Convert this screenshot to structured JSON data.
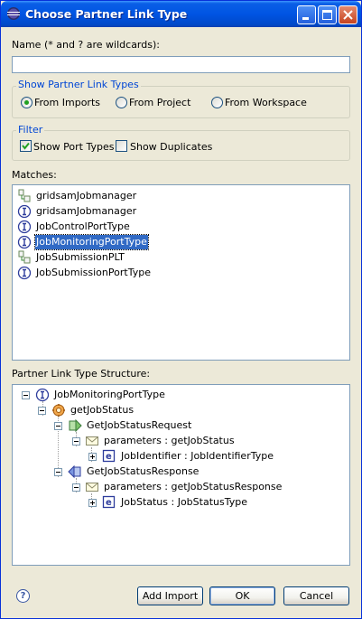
{
  "window": {
    "title": "Choose Partner Link Type"
  },
  "name_field": {
    "label": "Name (* and ? are wildcards):",
    "value": ""
  },
  "show_group": {
    "title": "Show Partner Link Types",
    "options": [
      "From Imports",
      "From Project",
      "From Workspace"
    ],
    "selected": "From Imports"
  },
  "filter_group": {
    "title": "Filter",
    "show_port_types": {
      "label": "Show Port Types",
      "checked": true
    },
    "show_duplicates": {
      "label": "Show Duplicates",
      "checked": false
    }
  },
  "matches": {
    "label": "Matches:",
    "items": [
      {
        "label": "gridsamJobmanager",
        "icon": "partner-link-type-icon"
      },
      {
        "label": "gridsamJobmanager",
        "icon": "port-type-icon"
      },
      {
        "label": "JobControlPortType",
        "icon": "port-type-icon"
      },
      {
        "label": "JobMonitoringPortType",
        "icon": "port-type-icon",
        "selected": true
      },
      {
        "label": "JobSubmissionPLT",
        "icon": "partner-link-type-icon"
      },
      {
        "label": "JobSubmissionPortType",
        "icon": "port-type-icon"
      }
    ]
  },
  "structure": {
    "label": "Partner Link Type Structure:",
    "nodes": [
      {
        "label": "JobMonitoringPortType",
        "icon": "port-type-icon",
        "expander": "minus"
      },
      {
        "label": "getJobStatus",
        "icon": "operation-icon",
        "expander": "minus"
      },
      {
        "label": "GetJobStatusRequest",
        "icon": "input-message-icon",
        "expander": "minus"
      },
      {
        "label": "parameters : getJobStatus",
        "icon": "message-part-icon",
        "expander": "minus"
      },
      {
        "label": "JobIdentifier : JobIdentifierType",
        "icon": "element-icon",
        "expander": "plus"
      },
      {
        "label": "GetJobStatusResponse",
        "icon": "output-message-icon",
        "expander": "minus"
      },
      {
        "label": "parameters : getJobStatusResponse",
        "icon": "message-part-icon",
        "expander": "minus"
      },
      {
        "label": "JobStatus : JobStatusType",
        "icon": "element-icon",
        "expander": "plus"
      }
    ]
  },
  "buttons": {
    "help": "?",
    "add_import": "Add Import",
    "ok": "OK",
    "cancel": "Cancel"
  },
  "colors": {
    "titlebar": "#0054e3",
    "selection": "#316ac5",
    "group_title": "#0046d5"
  }
}
